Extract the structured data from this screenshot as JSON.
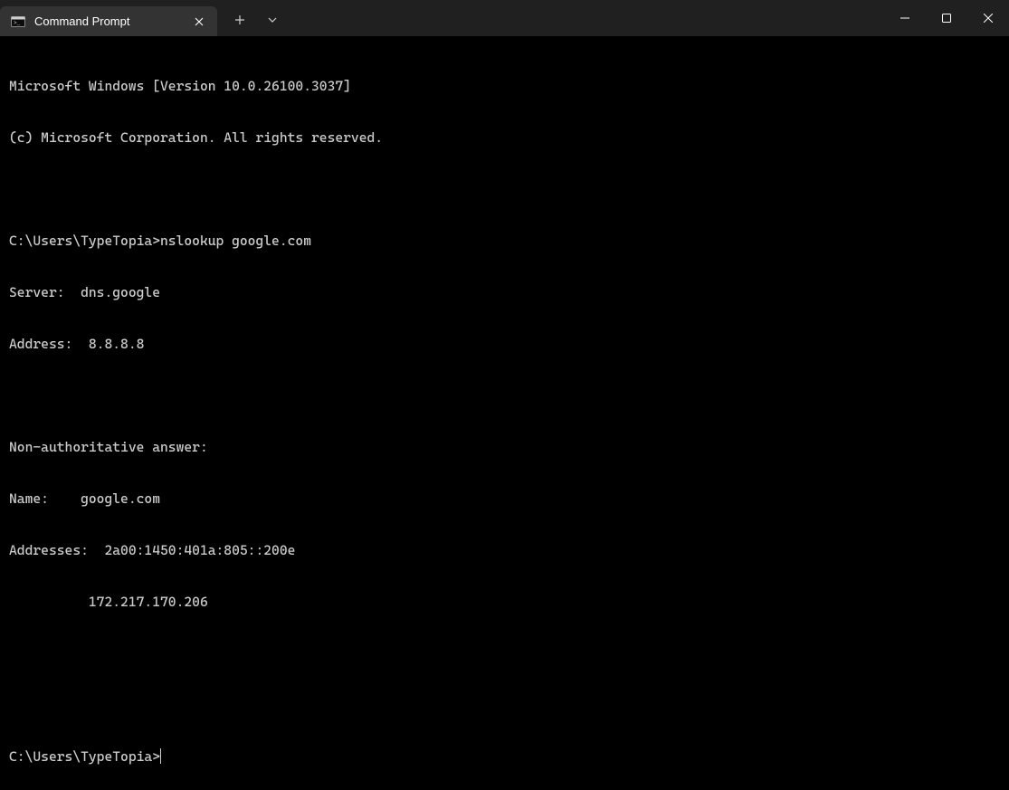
{
  "titlebar": {
    "tab": {
      "title": "Command Prompt"
    }
  },
  "terminal": {
    "lines": [
      "Microsoft Windows [Version 10.0.26100.3037]",
      "(c) Microsoft Corporation. All rights reserved.",
      "",
      "C:\\Users\\TypeTopia>nslookup google.com",
      "Server:  dns.google",
      "Address:  8.8.8.8",
      "",
      "Non-authoritative answer:",
      "Name:    google.com",
      "Addresses:  2a00:1450:401a:805::200e",
      "          172.217.170.206",
      "",
      ""
    ],
    "prompt": "C:\\Users\\TypeTopia>"
  }
}
